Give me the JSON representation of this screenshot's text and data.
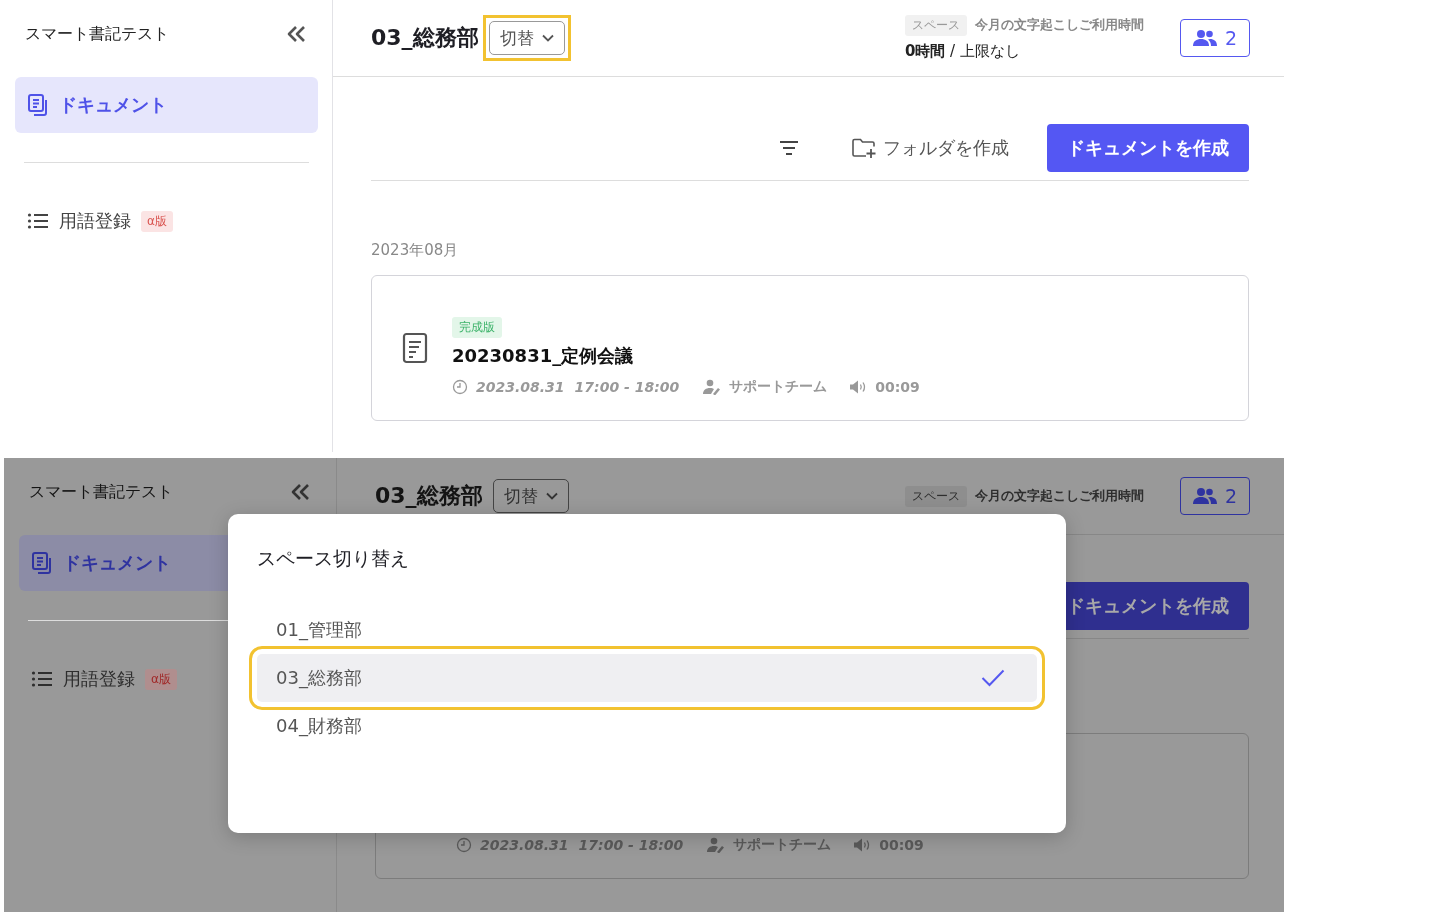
{
  "screens": [
    {
      "dimmed": false,
      "sidebar": {
        "title": "スマート書記テスト",
        "items": [
          {
            "label": "ドキュメント",
            "selected": true,
            "kind": "documents"
          },
          {
            "label": "用語登録",
            "selected": false,
            "kind": "glossary",
            "badge": "α版"
          }
        ]
      },
      "header": {
        "title": "03_総務部",
        "switch_button": {
          "label": "切替",
          "highlighted": true
        },
        "space_tag": "スペース",
        "usage_label": "今月の文字起こしご利用時間",
        "usage_value": "**0時間** / 上限なし",
        "members": "2"
      },
      "toolbar": {
        "folder_button": "フォルダを作成",
        "create_button": "ドキュメントを作成"
      },
      "month": "2023年08月",
      "document": {
        "status": "完成版",
        "title": "20230831_定例会議",
        "date": "2023.08.31",
        "time": "17:00 - 18:00",
        "owner": "サポートチーム",
        "duration": "00:09"
      }
    },
    {
      "dimmed": true,
      "sidebar": {
        "title": "スマート書記テスト",
        "items": [
          {
            "label": "ドキュメント",
            "selected": true,
            "kind": "documents"
          },
          {
            "label": "用語登録",
            "selected": false,
            "kind": "glossary",
            "badge": "α版"
          }
        ]
      },
      "header": {
        "title": "03_総務部",
        "switch_button": {
          "label": "切替",
          "highlighted": false
        },
        "space_tag": "スペース",
        "usage_label": "今月の文字起こしご利用時間",
        "members": "2"
      },
      "toolbar": {
        "create_button": "ドキュメントを作成"
      },
      "document": {
        "date": "2023.08.31",
        "time": "17:00 - 18:00",
        "owner": "サポートチーム",
        "duration": "00:09"
      },
      "modal": {
        "title": "スペース切り替え",
        "options": [
          {
            "label": "01_管理部",
            "selected": false,
            "highlighted": false
          },
          {
            "label": "03_総務部",
            "selected": true,
            "highlighted": true
          },
          {
            "label": "04_財務部",
            "selected": false,
            "highlighted": false
          }
        ]
      }
    }
  ]
}
